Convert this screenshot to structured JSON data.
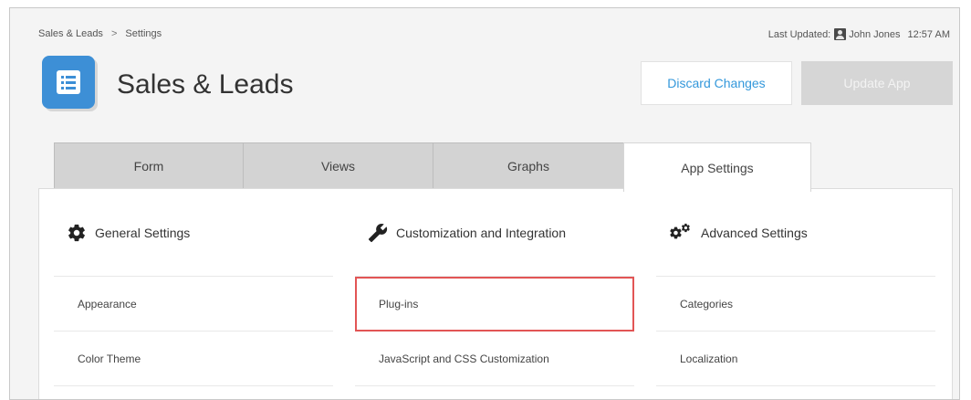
{
  "breadcrumb": {
    "parent": "Sales & Leads",
    "separator": ">",
    "current": "Settings"
  },
  "last_updated": {
    "label": "Last Updated:",
    "user": "John Jones",
    "time": "12:57 AM"
  },
  "app": {
    "title": "Sales & Leads",
    "icon": "list-document-icon"
  },
  "buttons": {
    "discard": "Discard Changes",
    "update": "Update App"
  },
  "tabs": [
    {
      "label": "Form"
    },
    {
      "label": "Views"
    },
    {
      "label": "Graphs"
    },
    {
      "label": "App Settings",
      "active": true
    }
  ],
  "sections": [
    {
      "title": "General Settings",
      "icon": "gear-icon",
      "items": [
        "Appearance",
        "Color Theme"
      ]
    },
    {
      "title": "Customization and Integration",
      "icon": "wrench-icon",
      "items": [
        "Plug-ins",
        "JavaScript and CSS Customization"
      ]
    },
    {
      "title": "Advanced Settings",
      "icon": "gears-icon",
      "items": [
        "Categories",
        "Localization"
      ]
    }
  ],
  "colors": {
    "accent": "#3498db",
    "app_icon": "#3d8fd6",
    "highlight": "#e25555"
  }
}
